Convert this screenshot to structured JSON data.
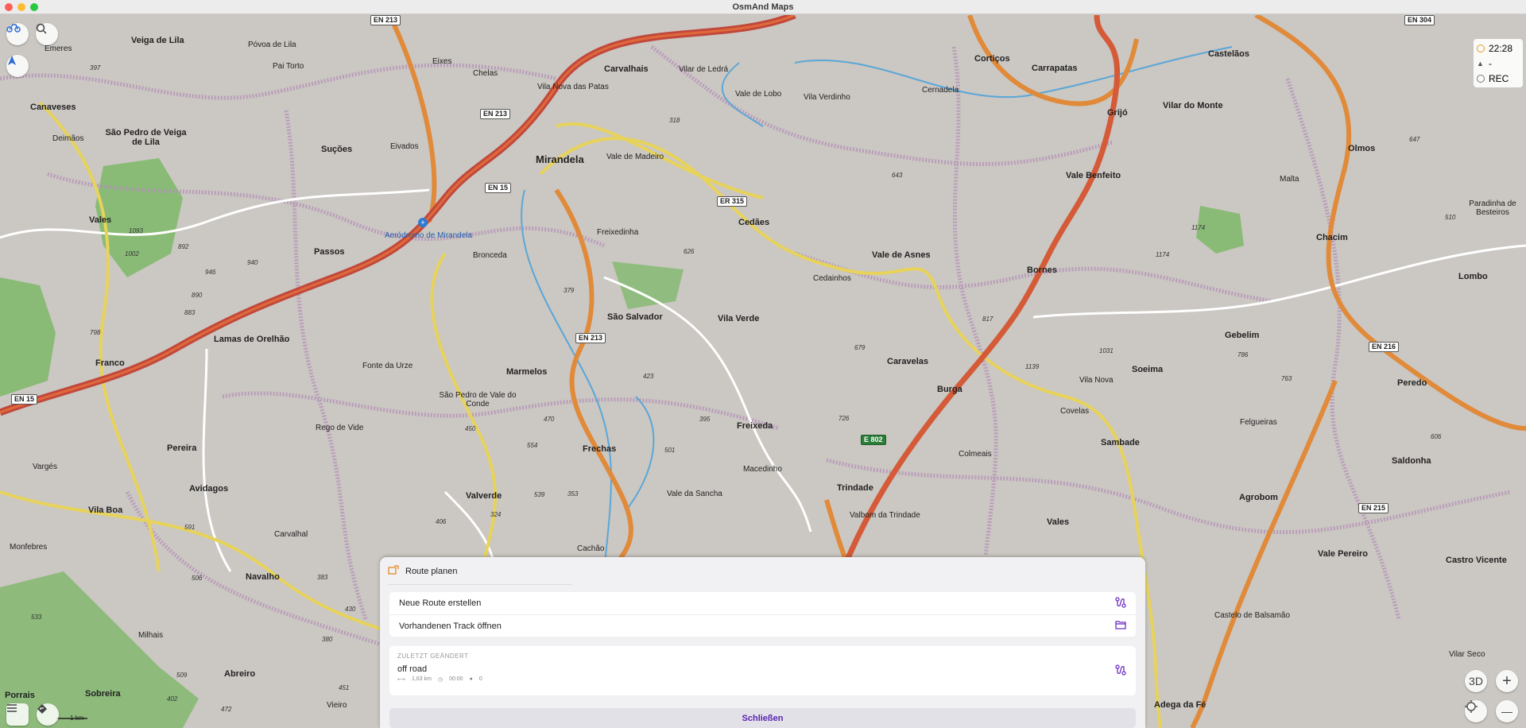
{
  "window": {
    "title": "OsmAnd Maps"
  },
  "widgets": {
    "time": "22:28",
    "altitude": "-",
    "rec": "REC"
  },
  "map": {
    "buttons": {
      "threed": "3D",
      "zoom_in": "+",
      "zoom_out": "—"
    },
    "scale": "1 km",
    "places": [
      {
        "name": "Mirandela",
        "size": "big"
      },
      {
        "name": "Carvalhais",
        "size": "town"
      },
      {
        "name": "Veiga de Lila",
        "size": "town"
      },
      {
        "name": "Emeres",
        "size": "small"
      },
      {
        "name": "Póvoa de Lila",
        "size": "small"
      },
      {
        "name": "Pai Torto",
        "size": "small"
      },
      {
        "name": "Eixes",
        "size": "small"
      },
      {
        "name": "Chelas",
        "size": "small"
      },
      {
        "name": "Vila Nova das Patas",
        "size": "small"
      },
      {
        "name": "Vilar de Ledrá",
        "size": "small"
      },
      {
        "name": "Vale de Lobo",
        "size": "small"
      },
      {
        "name": "Vila Verdinho",
        "size": "small"
      },
      {
        "name": "Cernadela",
        "size": "small"
      },
      {
        "name": "Cortiços",
        "size": "town"
      },
      {
        "name": "Carrapatas",
        "size": "town"
      },
      {
        "name": "Castelãos",
        "size": "town"
      },
      {
        "name": "Vilar do Monte",
        "size": "town"
      },
      {
        "name": "Grijó",
        "size": "town"
      },
      {
        "name": "Canaveses",
        "size": "town"
      },
      {
        "name": "São Pedro de Veiga de Lila",
        "size": "town"
      },
      {
        "name": "Deimãos",
        "size": "small"
      },
      {
        "name": "Suções",
        "size": "town"
      },
      {
        "name": "Eivados",
        "size": "small"
      },
      {
        "name": "Vale de Madeiro",
        "size": "small"
      },
      {
        "name": "Olmos",
        "size": "town"
      },
      {
        "name": "Malta",
        "size": "small"
      },
      {
        "name": "Vale Benfeito",
        "size": "town"
      },
      {
        "name": "Paradinha de Besteiros",
        "size": "small"
      },
      {
        "name": "Vales",
        "size": "town"
      },
      {
        "name": "Cedães",
        "size": "town"
      },
      {
        "name": "Freixedinha",
        "size": "small"
      },
      {
        "name": "Aeródromo de Mirandela",
        "size": "blue"
      },
      {
        "name": "Passos",
        "size": "town"
      },
      {
        "name": "Bronceda",
        "size": "small"
      },
      {
        "name": "Vale de Asnes",
        "size": "town"
      },
      {
        "name": "Cedainhos",
        "size": "small"
      },
      {
        "name": "Bornes",
        "size": "town"
      },
      {
        "name": "Chacim",
        "size": "town"
      },
      {
        "name": "Lombo",
        "size": "town"
      },
      {
        "name": "São Salvador",
        "size": "town"
      },
      {
        "name": "Vila Verde",
        "size": "town"
      },
      {
        "name": "Lamas de Orelhão",
        "size": "town"
      },
      {
        "name": "Gebelim",
        "size": "town"
      },
      {
        "name": "Soeima",
        "size": "town"
      },
      {
        "name": "Franco",
        "size": "town"
      },
      {
        "name": "Fonte da Urze",
        "size": "small"
      },
      {
        "name": "Marmelos",
        "size": "town"
      },
      {
        "name": "Caravelas",
        "size": "town"
      },
      {
        "name": "Vila Nova",
        "size": "small"
      },
      {
        "name": "Peredo",
        "size": "town"
      },
      {
        "name": "Burga",
        "size": "town"
      },
      {
        "name": "São Pedro de Vale do Conde",
        "size": "small"
      },
      {
        "name": "Covelas",
        "size": "small"
      },
      {
        "name": "Rego de Vide",
        "size": "small"
      },
      {
        "name": "Freixeda",
        "size": "town"
      },
      {
        "name": "Felgueiras",
        "size": "small"
      },
      {
        "name": "Sambade",
        "size": "town"
      },
      {
        "name": "Pereira",
        "size": "town"
      },
      {
        "name": "Frechas",
        "size": "town"
      },
      {
        "name": "Colmeais",
        "size": "small"
      },
      {
        "name": "Saldonha",
        "size": "town"
      },
      {
        "name": "Vargés",
        "size": "small"
      },
      {
        "name": "Macedinho",
        "size": "small"
      },
      {
        "name": "Avidagos",
        "size": "town"
      },
      {
        "name": "Trindade",
        "size": "town"
      },
      {
        "name": "Agrobom",
        "size": "town"
      },
      {
        "name": "Valverde",
        "size": "town"
      },
      {
        "name": "Vale da Sancha",
        "size": "small"
      },
      {
        "name": "Valbom da Trindade",
        "size": "small"
      },
      {
        "name": "Vila Boa",
        "size": "town"
      },
      {
        "name": "Vales",
        "size": "town"
      },
      {
        "name": "Carvalhal",
        "size": "small"
      },
      {
        "name": "Monfebres",
        "size": "small"
      },
      {
        "name": "Cachão",
        "size": "small"
      },
      {
        "name": "Vale Pereiro",
        "size": "town"
      },
      {
        "name": "Castro Vicente",
        "size": "town"
      },
      {
        "name": "Navalho",
        "size": "town"
      },
      {
        "name": "Castelo de Balsamão",
        "size": "small"
      },
      {
        "name": "Milhais",
        "size": "small"
      },
      {
        "name": "Abreiro",
        "size": "town"
      },
      {
        "name": "Vilar Seco",
        "size": "small"
      },
      {
        "name": "Porrais",
        "size": "town"
      },
      {
        "name": "Sobreira",
        "size": "town"
      },
      {
        "name": "Vieiro",
        "size": "small"
      },
      {
        "name": "Adega da Fé",
        "size": "town"
      }
    ],
    "peaks": [
      "397",
      "643",
      "647",
      "1093",
      "892",
      "510",
      "1002",
      "946",
      "940",
      "1174",
      "1174",
      "890",
      "626",
      "379",
      "883",
      "798",
      "679",
      "1031",
      "786",
      "1139",
      "763",
      "423",
      "606",
      "450",
      "470",
      "726",
      "395",
      "554",
      "501",
      "539",
      "353",
      "406",
      "324",
      "591",
      "506",
      "383",
      "430",
      "380",
      "533",
      "451",
      "472",
      "509",
      "402",
      "817",
      "318"
    ],
    "shields": [
      {
        "label": "EN 213",
        "green": false
      },
      {
        "label": "EN 213",
        "green": false
      },
      {
        "label": "EN 15",
        "green": false
      },
      {
        "label": "ER 315",
        "green": false
      },
      {
        "label": "EN 213",
        "green": false
      },
      {
        "label": "EN 15",
        "green": false
      },
      {
        "label": "EN 216",
        "green": false
      },
      {
        "label": "E 802",
        "green": true
      },
      {
        "label": "EN 215",
        "green": false
      },
      {
        "label": "EN 304",
        "green": false
      }
    ]
  },
  "sheet": {
    "title": "Route planen",
    "new_route": "Neue Route erstellen",
    "open_track": "Vorhandenen Track öffnen",
    "recent_header": "ZULETZT GEÄNDERT",
    "recent_name": "off road",
    "recent_distance": "1,63 km",
    "recent_time": "00:00",
    "recent_points": "0",
    "close": "Schließen"
  }
}
